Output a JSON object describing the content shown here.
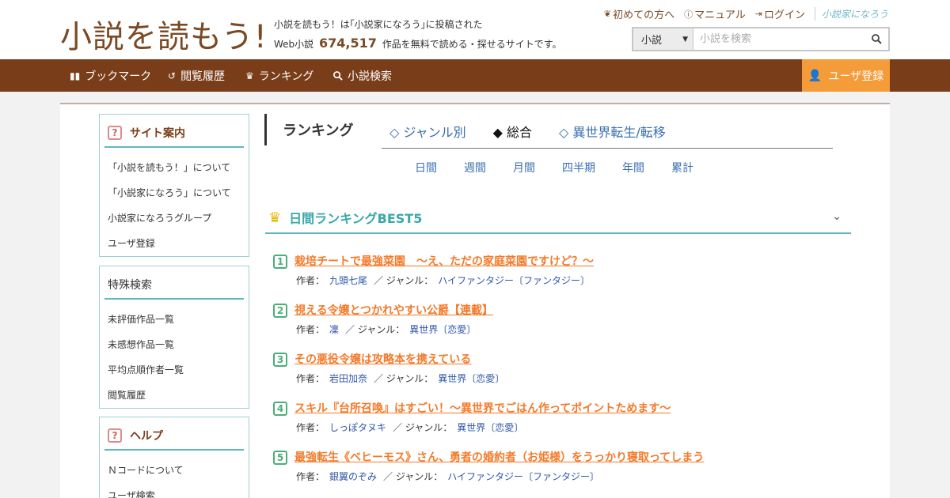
{
  "header": {
    "logo_text": "小説を読もう!",
    "tagline_line1": "小説を読もう！は｢小説家になろう｣に投稿された",
    "tagline_prefix": "Web小説",
    "work_count": "674,517",
    "tagline_suffix": "作品を無料で読める・探せるサイトです。",
    "top_links": [
      {
        "icon": "beginner-icon",
        "label": "初めての方へ"
      },
      {
        "icon": "question-icon",
        "label": "マニュアル"
      },
      {
        "icon": "login-icon",
        "label": "ログイン"
      }
    ],
    "brand_link": "小説家になろう",
    "search": {
      "select_value": "小説",
      "placeholder": "小説を検索"
    }
  },
  "nav": {
    "items": [
      {
        "icon": "bookmark-icon",
        "label": "ブックマーク"
      },
      {
        "icon": "history-icon",
        "label": "閲覧履歴"
      },
      {
        "icon": "crown-icon",
        "label": "ランキング"
      },
      {
        "icon": "search-icon",
        "label": "小説検索"
      }
    ],
    "register_label": "ユーザ登録"
  },
  "sidebar": {
    "site_guide": {
      "title": "サイト案内",
      "links": [
        "「小説を読もう！」について",
        "「小説家になろう」について",
        "小説家になろうグループ",
        "ユーザ登録"
      ]
    },
    "special_search": {
      "title": "特殊検索",
      "links": [
        "未評価作品一覧",
        "未感想作品一覧",
        "平均点順作者一覧",
        "閲覧履歴"
      ]
    },
    "help": {
      "title": "ヘルプ",
      "links": [
        "Ｎコードについて",
        "ユーザ検索"
      ]
    }
  },
  "ranking": {
    "header": "ランキング",
    "tabs": [
      "◇ ジャンル別",
      "◆ 総合",
      "◇ 異世界転生/転移"
    ],
    "active_tab": 1,
    "periods": [
      "日間",
      "週間",
      "月間",
      "四半期",
      "年間",
      "累計"
    ],
    "best5_title": "日間ランキングBEST5",
    "author_label": "作者：",
    "genre_label": "／ ジャンル：",
    "entries": [
      {
        "rank": "1",
        "title": "栽培チートで最強菜園　～え、ただの家庭菜園ですけど？～",
        "author": "九頭七尾",
        "genre": "ハイファンタジー〔ファンタジー〕"
      },
      {
        "rank": "2",
        "title": "視える令嬢とつかれやすい公爵【連載】",
        "author": "凜",
        "genre": "異世界〔恋愛〕"
      },
      {
        "rank": "3",
        "title": "その悪役令嬢は攻略本を携えている",
        "author": "岩田加奈",
        "genre": "異世界〔恋愛〕"
      },
      {
        "rank": "4",
        "title": "スキル『台所召喚』はすごい！～異世界でごはん作ってポイントためます～",
        "author": "しっぽタヌキ",
        "genre": "異世界〔恋愛〕"
      },
      {
        "rank": "5",
        "title": "最強転生《ベヒーモス》さん、勇者の婚約者（お姫様）をうっかり寝取ってしまう",
        "author": "銀翼のぞみ",
        "genre": "ハイファンタジー〔ファンタジー〕"
      }
    ]
  },
  "colors": {
    "brand_brown": "#7a3d19",
    "register_orange": "#f49b3a",
    "teal_accent": "#5fb8bd",
    "title_orange": "#f47a2a",
    "link_blue": "#2f56a8"
  }
}
